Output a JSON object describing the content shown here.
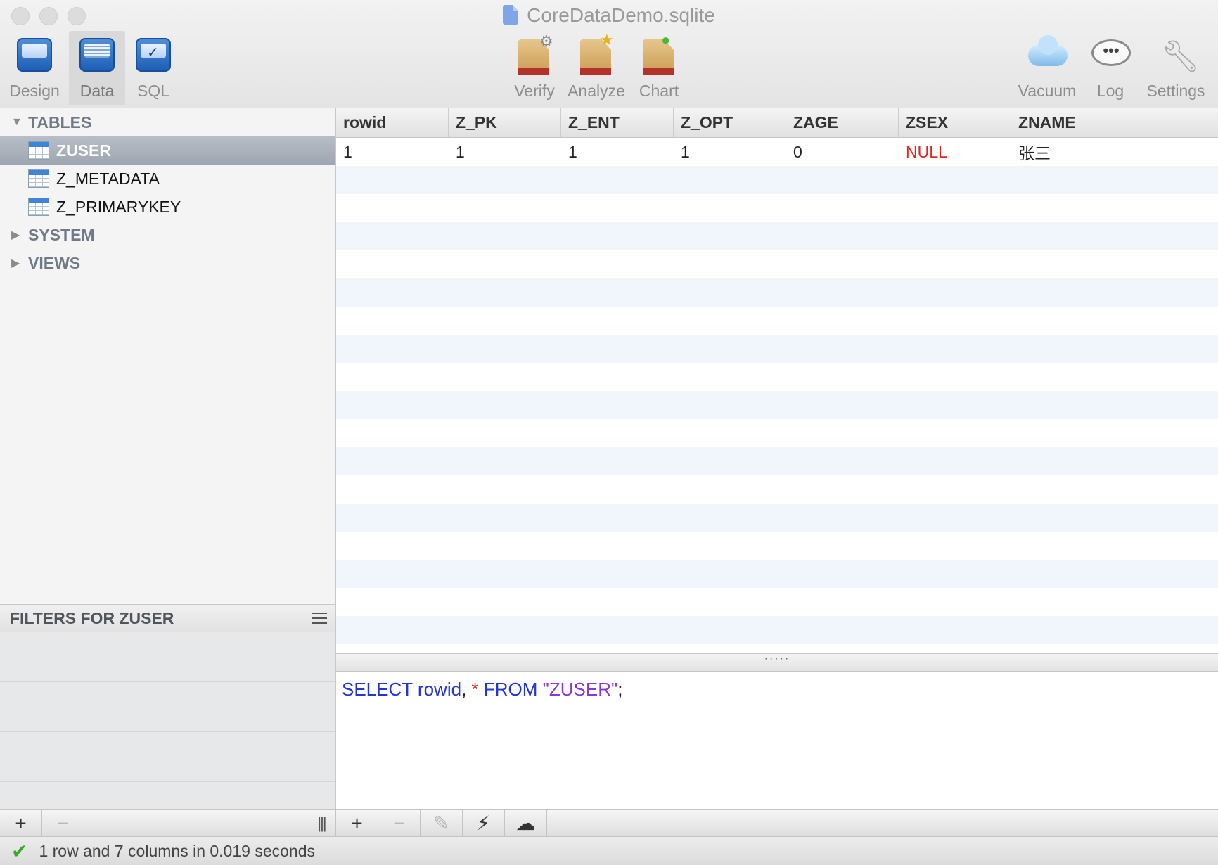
{
  "window": {
    "title": "CoreDataDemo.sqlite"
  },
  "toolbar": {
    "left": [
      {
        "id": "design",
        "label": "Design"
      },
      {
        "id": "data",
        "label": "Data",
        "active": true
      },
      {
        "id": "sql",
        "label": "SQL"
      }
    ],
    "center": [
      {
        "id": "verify",
        "label": "Verify"
      },
      {
        "id": "analyze",
        "label": "Analyze"
      },
      {
        "id": "chart",
        "label": "Chart"
      }
    ],
    "right": [
      {
        "id": "vacuum",
        "label": "Vacuum"
      },
      {
        "id": "log",
        "label": "Log"
      },
      {
        "id": "settings",
        "label": "Settings"
      }
    ]
  },
  "sidebar": {
    "tables_label": "TABLES",
    "tables": [
      "ZUSER",
      "Z_METADATA",
      "Z_PRIMARYKEY"
    ],
    "selected_table": "ZUSER",
    "system_label": "SYSTEM",
    "views_label": "VIEWS"
  },
  "filters": {
    "title": "FILTERS FOR ZUSER"
  },
  "grid": {
    "columns": [
      "rowid",
      "Z_PK",
      "Z_ENT",
      "Z_OPT",
      "ZAGE",
      "ZSEX",
      "ZNAME"
    ],
    "rows": [
      [
        "1",
        "1",
        "1",
        "1",
        "0",
        "NULL",
        "张三"
      ]
    ]
  },
  "sql_editor": {
    "kw_select": "SELECT",
    "col_rowid": "rowid",
    "comma": ",",
    "star": "*",
    "kw_from": "FROM",
    "table": "\"ZUSER\"",
    "semicolon": ";"
  },
  "status": {
    "text": "1 row and 7 columns in 0.019 seconds"
  },
  "colors": {
    "accent_blue": "#2435d6",
    "null_red": "#e0261e",
    "string_purple": "#8a39d6",
    "ok_green": "#3aa829"
  }
}
